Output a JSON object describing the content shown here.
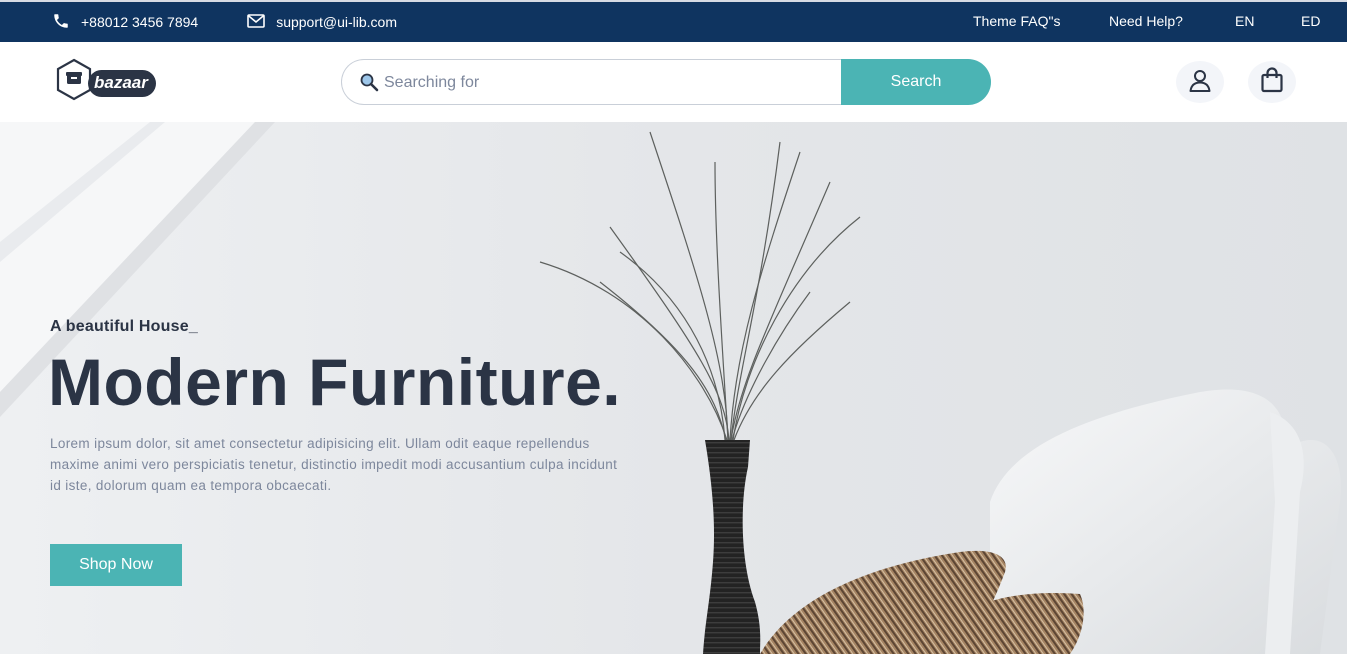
{
  "topbar": {
    "phone": "+88012 3456 7894",
    "email": "support@ui-lib.com",
    "links": [
      "Theme FAQ\"s",
      "Need Help?",
      "EN",
      "ED"
    ],
    "icons": {
      "phone": "phone-icon",
      "email": "mail-icon"
    }
  },
  "header": {
    "logo_text": "bazaar",
    "search": {
      "placeholder": "Searching for",
      "value": "",
      "button_label": "Search"
    },
    "icons": {
      "search": "magnifier-icon",
      "user": "user-icon",
      "cart": "shopping-bag-icon"
    }
  },
  "hero": {
    "subtitle": "A beautiful House_",
    "title": "Modern Furniture.",
    "description": "Lorem ipsum dolor, sit amet consectetur adipisicing elit. Ullam odit eaque repellendus maxime animi vero perspiciatis tenetur, distinctio impedit modi accusantium culpa incidunt id iste, dolorum quam ea tempora obcaecati.",
    "cta_label": "Shop Now"
  },
  "colors": {
    "topbar_bg": "#0f3460",
    "accent": "#4bb4b4",
    "text_dark": "#2b3445",
    "text_muted": "#7d879c"
  }
}
